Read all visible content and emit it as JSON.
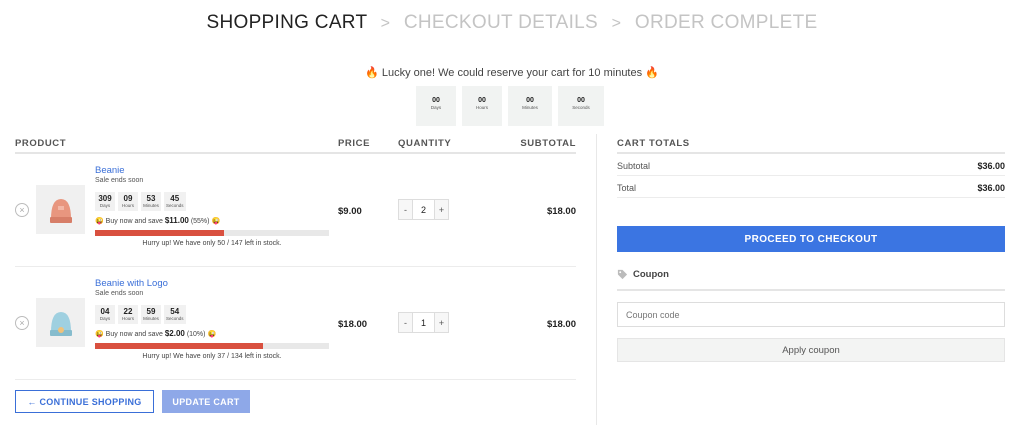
{
  "steps": {
    "step1": "SHOPPING CART",
    "step2": "CHECKOUT DETAILS",
    "step3": "ORDER COMPLETE",
    "separator": ">"
  },
  "reserve": {
    "message": "Lucky one! We could reserve your cart for 10 minutes",
    "timer": [
      {
        "value": "00",
        "label": "Days"
      },
      {
        "value": "00",
        "label": "Hours"
      },
      {
        "value": "00",
        "label": "Minutes"
      },
      {
        "value": "00",
        "label": "Seconds"
      }
    ]
  },
  "table": {
    "headers": {
      "product": "PRODUCT",
      "price": "PRICE",
      "quantity": "QUANTITY",
      "subtotal": "SUBTOTAL"
    },
    "items": [
      {
        "name": "Beanie",
        "sale_text": "Sale ends soon",
        "countdown": [
          {
            "value": "309",
            "label": "Days"
          },
          {
            "value": "09",
            "label": "Hours"
          },
          {
            "value": "53",
            "label": "Minutes"
          },
          {
            "value": "45",
            "label": "Seconds"
          }
        ],
        "save_prefix": "Buy now and save",
        "save_amount": "$11.00",
        "save_percent": "(55%)",
        "stock_text": "Hurry up! We have only 50 / 147 left in stock.",
        "stock_fraction": 0.55,
        "price": "$9.00",
        "qty": "2",
        "subtotal": "$18.00",
        "color": "#e8967f"
      },
      {
        "name": "Beanie with Logo",
        "sale_text": "Sale ends soon",
        "countdown": [
          {
            "value": "04",
            "label": "Days"
          },
          {
            "value": "22",
            "label": "Hours"
          },
          {
            "value": "59",
            "label": "Minutes"
          },
          {
            "value": "54",
            "label": "Seconds"
          }
        ],
        "save_prefix": "Buy now and save",
        "save_amount": "$2.00",
        "save_percent": "(10%)",
        "stock_text": "Hurry up! We have only 37 / 134 left in stock.",
        "stock_fraction": 0.72,
        "price": "$18.00",
        "qty": "1",
        "subtotal": "$18.00",
        "color": "#9fd0e0"
      }
    ]
  },
  "actions": {
    "continue": "← CONTINUE SHOPPING",
    "update": "UPDATE CART"
  },
  "totals": {
    "title": "CART TOTALS",
    "subtotal_label": "Subtotal",
    "subtotal_value": "$36.00",
    "total_label": "Total",
    "total_value": "$36.00",
    "checkout": "PROCEED TO CHECKOUT",
    "coupon_title": "Coupon",
    "coupon_placeholder": "Coupon code",
    "apply": "Apply coupon"
  },
  "colors": {
    "accent": "#3b75e2",
    "link": "#3a6fd8",
    "stock_bar": "#d9503f"
  }
}
